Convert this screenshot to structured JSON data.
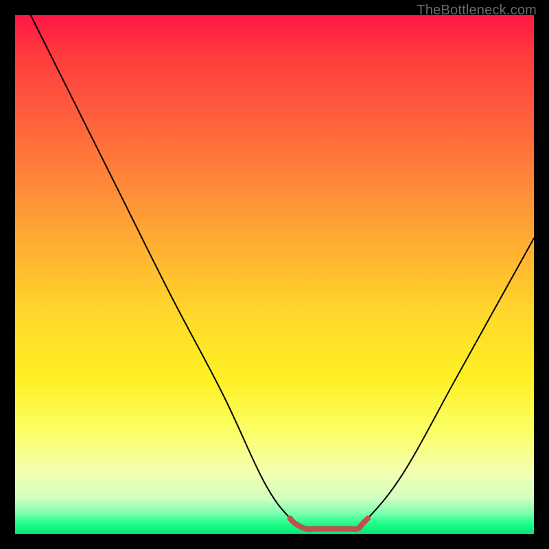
{
  "watermark": "TheBottleneck.com",
  "chart_data": {
    "type": "line",
    "title": "",
    "xlabel": "",
    "ylabel": "",
    "xlim": [
      0,
      100
    ],
    "ylim": [
      0,
      100
    ],
    "series": [
      {
        "name": "bottleneck-curve",
        "color": "#000000",
        "x": [
          3,
          10,
          20,
          30,
          40,
          48,
          53,
          56,
          60,
          65,
          68,
          75,
          85,
          95,
          100
        ],
        "values": [
          100,
          86,
          66,
          46,
          27,
          10,
          3,
          1,
          1,
          1,
          3,
          12,
          30,
          48,
          57
        ]
      },
      {
        "name": "optimal-range-marker",
        "color": "#c0504d",
        "x": [
          53,
          54,
          56,
          58,
          60,
          62,
          64,
          66,
          67,
          68
        ],
        "values": [
          3,
          2,
          1,
          1,
          1,
          1,
          1,
          1,
          2,
          3
        ]
      }
    ],
    "gradient_stops": [
      {
        "pos": 0,
        "color": "#ff1744"
      },
      {
        "pos": 50,
        "color": "#ffd92b"
      },
      {
        "pos": 85,
        "color": "#fbff64"
      },
      {
        "pos": 100,
        "color": "#00e676"
      }
    ]
  }
}
